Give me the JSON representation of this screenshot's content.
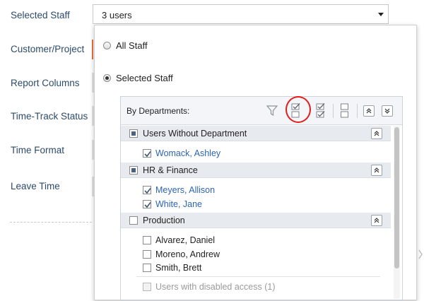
{
  "form": {
    "labels": {
      "selected_staff": "Selected Staff",
      "customer_project": "Customer/Project",
      "report_columns": "Report Columns",
      "time_track_status": "Time-Track Status",
      "time_format": "Time Format",
      "leave_time": "Leave Time"
    },
    "staff_select_value": "3 users"
  },
  "dropdown": {
    "all_staff_label": "All Staff",
    "selected_staff_label": "Selected Staff",
    "selected_option": "Selected Staff",
    "tree": {
      "header_title": "By Departments:",
      "toolbar_icons": [
        "filter-icon",
        "check-selected-icon",
        "check-all-icon",
        "uncheck-all-icon",
        "expand-all-icon",
        "collapse-all-icon"
      ],
      "departments": [
        {
          "name": "Users Without Department",
          "state": "partial",
          "users": [
            {
              "name": "Womack, Ashley",
              "checked": true
            }
          ]
        },
        {
          "name": "HR & Finance",
          "state": "partial",
          "users": [
            {
              "name": "Meyers, Allison",
              "checked": true
            },
            {
              "name": "White, Jane",
              "checked": true
            }
          ]
        },
        {
          "name": "Production",
          "state": "unchecked",
          "users": [
            {
              "name": "Alvarez, Daniel",
              "checked": false
            },
            {
              "name": "Moreno, Andrew",
              "checked": false
            },
            {
              "name": "Smith, Brett",
              "checked": false
            }
          ]
        }
      ],
      "disabled_users_label": "Users with disabled access (1)"
    }
  },
  "colors": {
    "label": "#2d4a6a",
    "link": "#2d64b3",
    "highlight": "#e31b1b",
    "dept_row_bg": "#e7ebf0"
  }
}
